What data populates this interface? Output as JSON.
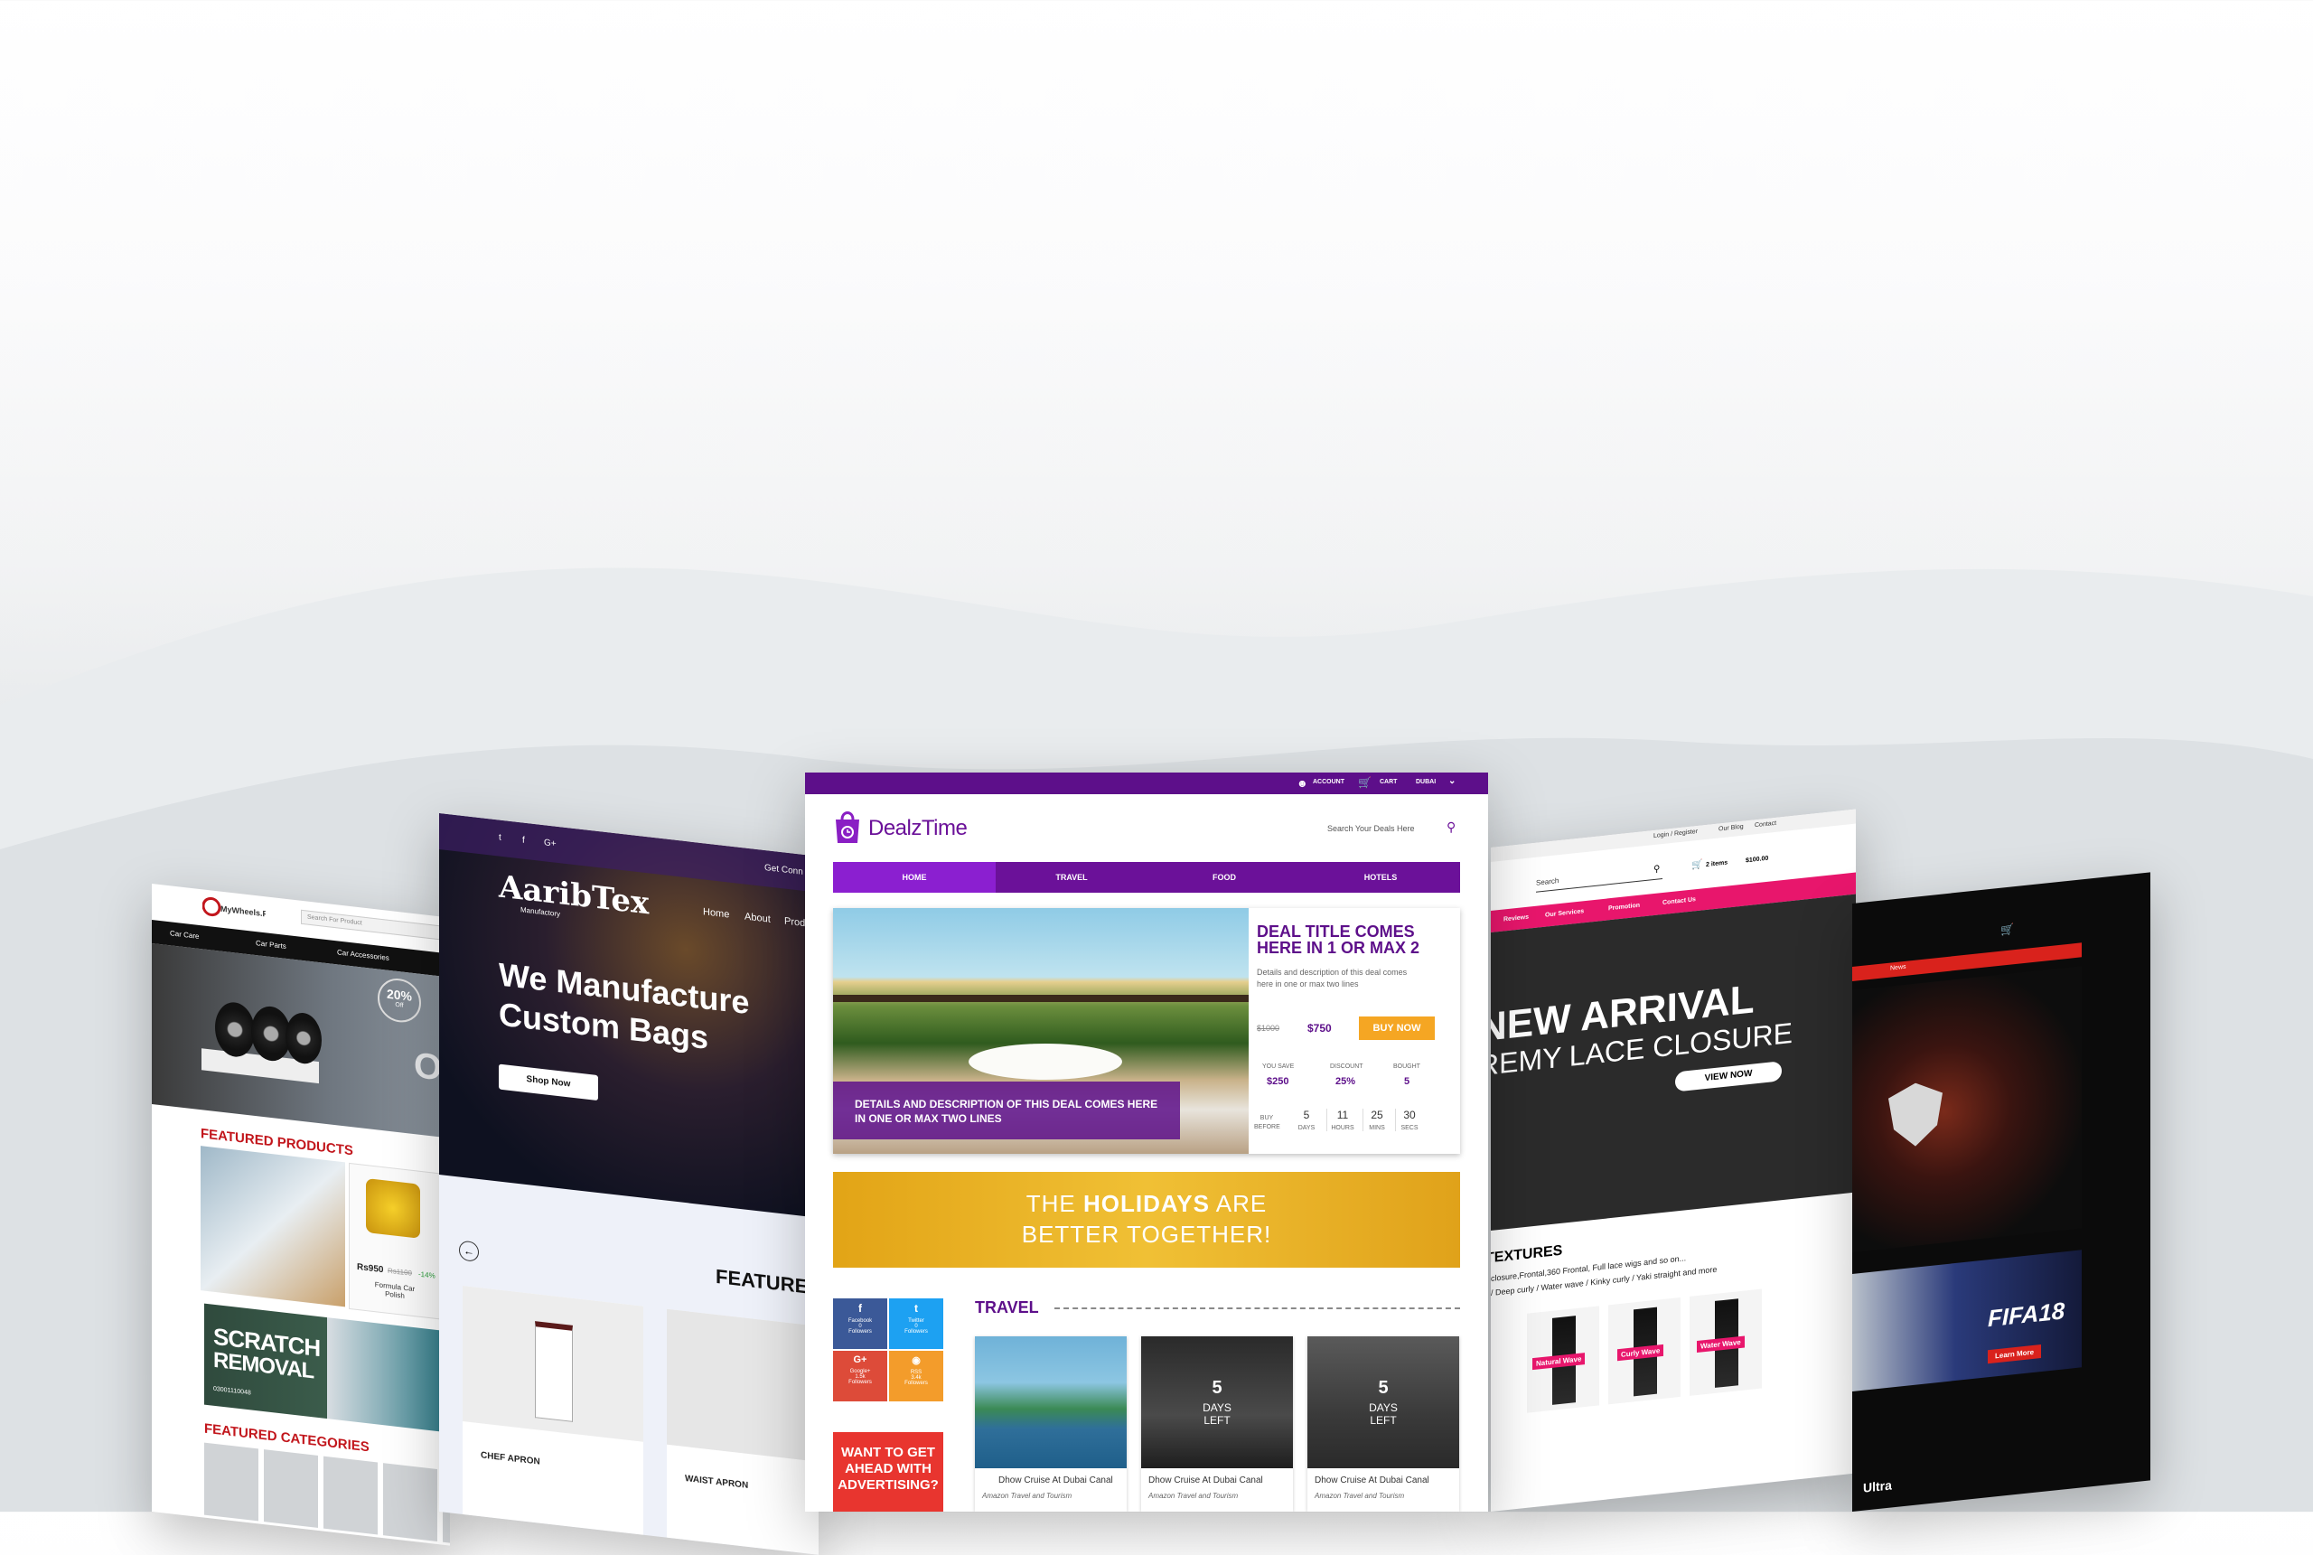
{
  "wheels": {
    "search_placeholder": "Search For Product",
    "nav": [
      "Car Care",
      "Car Parts",
      "Car Accessories"
    ],
    "hero_badge_percent": "20%",
    "hero_badge_off": "Off",
    "hero_text": "ON",
    "featured_products": "FEATURED PRODUCTS",
    "product_price": "Rs950",
    "product_old_price": "Rs1100",
    "product_discount": "-14%",
    "product_name": "Formula Car Polish",
    "scratch_line1": "SCRATCH",
    "scratch_line2": "REMOVAL",
    "scratch_phone": "03001110048",
    "featured_categories": "FEATURED CATEGORIES"
  },
  "aarib": {
    "social": [
      "t",
      "f",
      "G+"
    ],
    "get_connected": "Get Conn",
    "logo_main": "AaribTex",
    "logo_sub": "Manufactory",
    "nav": [
      "Home",
      "About",
      "Prod"
    ],
    "hero_line1": "We Manufacture",
    "hero_line2": "Custom Bags",
    "shop_now": "Shop Now",
    "featured": "FEATURE",
    "products": [
      "CHEF APRON",
      "WAIST APRON"
    ]
  },
  "dealz": {
    "top": {
      "account": "ACCOUNT",
      "cart": "CART",
      "city": "DUBAI"
    },
    "logo": "DealzTime",
    "search_placeholder": "Search Your Deals Here",
    "nav": [
      "HOME",
      "TRAVEL",
      "FOOD",
      "HOTELS"
    ],
    "deal": {
      "title_line1": "DEAL TITLE COMES",
      "title_line2": "HERE IN 1 OR MAX 2",
      "desc_line1": "Details and description of this deal comes",
      "desc_line2": "here in one or max two lines",
      "old_price": "$1000",
      "price": "$750",
      "buy_now": "BUY NOW",
      "you_save_label": "YOU SAVE",
      "you_save": "$250",
      "discount_label": "DISCOUNT",
      "discount": "25%",
      "bought_label": "BOUGHT",
      "bought": "5",
      "buy_before_label": "BUY BEFORE",
      "countdown": [
        {
          "value": "5",
          "unit": "DAYS"
        },
        {
          "value": "11",
          "unit": "HOURS"
        },
        {
          "value": "25",
          "unit": "MINS"
        },
        {
          "value": "30",
          "unit": "SECS"
        }
      ],
      "overlay_line1": "DETAILS AND DESCRIPTION OF THIS DEAL COMES HERE",
      "overlay_line2": "IN ONE OR MAX TWO LINES"
    },
    "banner_line1a": "THE ",
    "banner_line1b": "HOLIDAYS",
    "banner_line1c": " ARE",
    "banner_line2": "BETTER TOGETHER!",
    "social": [
      {
        "name": "Facebook",
        "count": "0",
        "label": "Followers"
      },
      {
        "name": "Twitter",
        "count": "0",
        "label": "Followers"
      },
      {
        "name": "Google+",
        "count": "1.5k",
        "label": "Followers"
      },
      {
        "name": "RSS",
        "count": "3.4k",
        "label": "Followers"
      }
    ],
    "ad_line1": "WANT TO GET",
    "ad_line2": "AHEAD WITH",
    "ad_line3": "ADVERTISING?",
    "travel_heading": "TRAVEL",
    "travel_cards": [
      {
        "days": "",
        "left": "",
        "title": "Dhow Cruise At Dubai Canal",
        "sub": "Amazon Travel and Tourism"
      },
      {
        "days": "5",
        "left": "DAYS LEFT",
        "title": "Dhow Cruise At Dubai Canal",
        "sub": "Amazon Travel and Tourism"
      },
      {
        "days": "5",
        "left": "DAYS LEFT",
        "title": "Dhow Cruise At Dubai Canal",
        "sub": "Amazon Travel and Tourism"
      }
    ]
  },
  "hair": {
    "top_links": [
      "Login / Register",
      "Our Blog",
      "Contact"
    ],
    "search_placeholder": "Search",
    "cart": "2 items",
    "cart_total": "$100.00",
    "nav": [
      "Reviews",
      "Our Services",
      "Promotion",
      "Contact Us"
    ],
    "hero_line1": "NEW ARRIVAL",
    "hero_line2": "REMY LACE CLOSURE",
    "view_now": "VIEW NOW",
    "textures_heading": "TEXTURES",
    "textures_text1": "closure,Frontal,360 Frontal, Full lace wigs and so on...",
    "textures_text2": "/ Deep curly / Water wave / Kinky curly / Yaki straight and more",
    "textures": [
      "Natural Wave",
      "Curly Wave",
      "Water Wave"
    ]
  },
  "game": {
    "nav": [
      "News"
    ],
    "fifa": "FIFA18",
    "learn_more": "Learn More",
    "ultra": "Ultra"
  },
  "colors": {
    "dealz_purple": "#6b1199",
    "dealz_dark_purple": "#5d0f8a",
    "dealz_orange": "#f5a623",
    "hair_pink": "#e8166c",
    "wheels_red": "#c2161c",
    "game_red": "#d9221c"
  }
}
